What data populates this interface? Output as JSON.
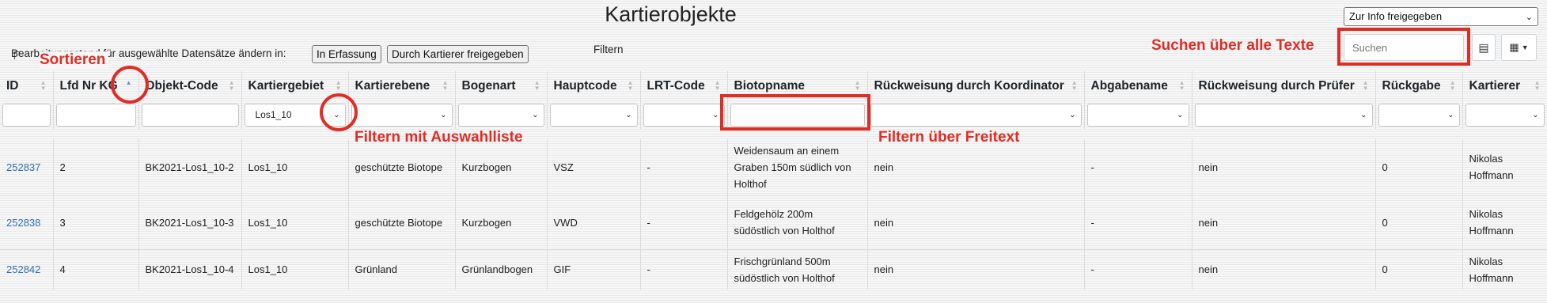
{
  "page": {
    "title": "Kartierobjekte",
    "status_select": "Zur Info freigegeben"
  },
  "toolbar": {
    "bulk_label": "Bearbeitungsstand für ausgewählte Datensätze ändern in:",
    "btn_in_erfassung": "In Erfassung",
    "btn_freigegeben": "Durch Kartierer freigegeben",
    "filter_label": "Filtern",
    "search_placeholder": "Suchen",
    "icons": [
      "list-icon",
      "grid-columns-icon",
      "caret-down-icon"
    ]
  },
  "annotations": {
    "sort": "Sortieren",
    "filter_select": "Filtern mit Auswahlliste",
    "filter_text": "Filtern über Freitext",
    "search_all": "Suchen über alle Texte",
    "color": "#e12c25"
  },
  "table": {
    "columns": [
      "ID",
      "Lfd Nr KG",
      "Objekt-Code",
      "Kartiergebiet",
      "Kartierebene",
      "Bogenart",
      "Hauptcode",
      "LRT-Code",
      "Biotopname",
      "Rückweisung durch Koordinator",
      "Abgabename",
      "Rückweisung durch Prüfer",
      "Rückgabe",
      "Kartierer"
    ],
    "filters": {
      "kartiergebiet_value": "Los1_10"
    },
    "rows": [
      {
        "id": "252837",
        "lfd": "2",
        "code": "BK2021-Los1_10-2",
        "gebiet": "Los1_10",
        "ebene": "geschützte Biotope",
        "bogen": "Kurzbogen",
        "haupt": "VSZ",
        "lrt": "-",
        "name": "Weidensaum an einem Graben 150m südlich von Holthof",
        "rk": "nein",
        "abgabe": "-",
        "rp": "nein",
        "rueck": "0",
        "kartierer": "Nikolas Hoffmann"
      },
      {
        "id": "252838",
        "lfd": "3",
        "code": "BK2021-Los1_10-3",
        "gebiet": "Los1_10",
        "ebene": "geschützte Biotope",
        "bogen": "Kurzbogen",
        "haupt": "VWD",
        "lrt": "-",
        "name": "Feldgehölz 200m südöstlich von Holthof",
        "rk": "nein",
        "abgabe": "-",
        "rp": "nein",
        "rueck": "0",
        "kartierer": "Nikolas Hoffmann"
      },
      {
        "id": "252842",
        "lfd": "4",
        "code": "BK2021-Los1_10-4",
        "gebiet": "Los1_10",
        "ebene": "Grünland",
        "bogen": "Grünlandbogen",
        "haupt": "GIF",
        "lrt": "-",
        "name": "Frischgrünland 500m südöstlich von Holthof",
        "rk": "nein",
        "abgabe": "-",
        "rp": "nein",
        "rueck": "0",
        "kartierer": "Nikolas Hoffmann"
      }
    ]
  }
}
